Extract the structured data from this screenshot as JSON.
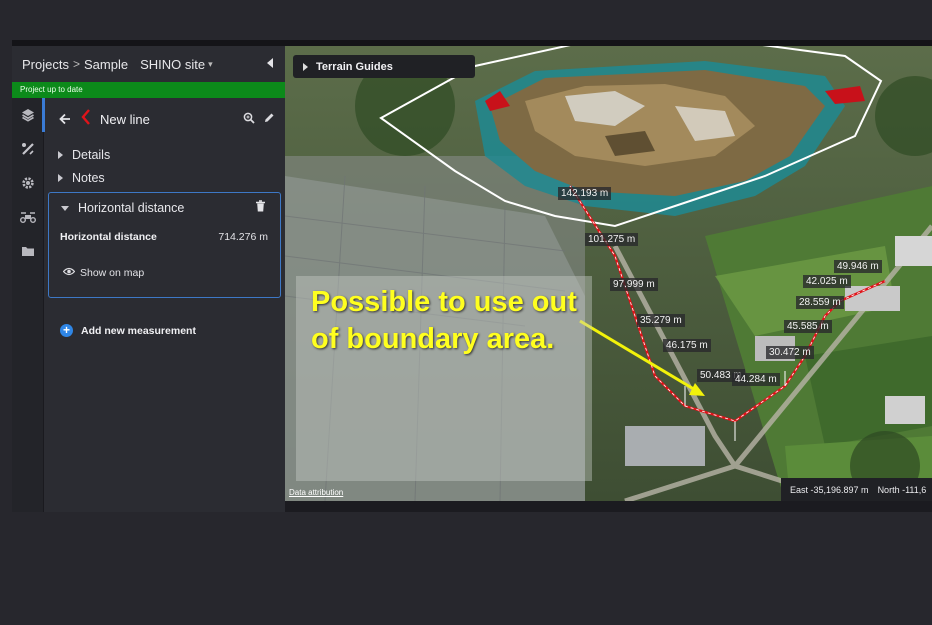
{
  "breadcrumb": {
    "projects": "Projects",
    "separator": ">",
    "project": "Sample",
    "site": "SHINO site",
    "site_caret": "▾"
  },
  "status": {
    "text": "Project up to date",
    "color": "#0c8a1a"
  },
  "rail_icons": [
    "layers-icon",
    "measure-tools-icon",
    "settings-icon",
    "drone-icon",
    "folder-icon"
  ],
  "measurement": {
    "title": "New line",
    "sections": {
      "details": "Details",
      "notes": "Notes"
    },
    "card": {
      "header": "Horizontal distance",
      "label": "Horizontal distance",
      "value": "714.276 m",
      "show_on_map": "Show on map"
    },
    "add_label": "Add new measurement"
  },
  "map": {
    "terrain_guides": "Terrain Guides",
    "segment_labels": [
      "142.193 m",
      "101.275 m",
      "97.999 m",
      "35.279 m",
      "46.175 m",
      "50.483 m",
      "44.284 m",
      "30.472 m",
      "45.585 m",
      "28.559 m",
      "42.025 m",
      "49.946 m"
    ],
    "annotation": "Possible to use out of boundary area.",
    "attribution": "Data attribution",
    "east": "East -35,196.897 m",
    "north": "North -111,6"
  },
  "colors": {
    "accent": "#3d78c6",
    "annotation": "#ffff1f",
    "line": "#e0141a"
  }
}
